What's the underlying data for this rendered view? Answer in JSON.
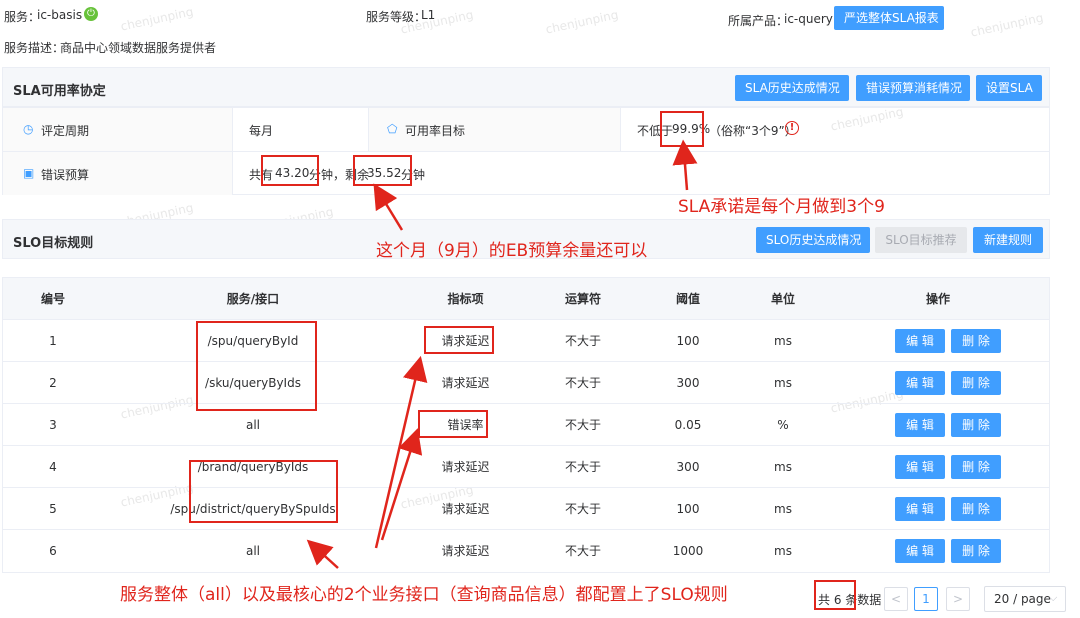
{
  "header": {
    "service_label": "服务：",
    "service_value": "ic-basis",
    "level_label": "服务等级：",
    "level_value": "L1",
    "product_label": "所属产品：",
    "product_value": "ic-query",
    "report_button": "严选整体SLA报表",
    "desc_label": "服务描述：",
    "desc_value": "商品中心领域数据服务提供者"
  },
  "sla": {
    "title": "SLA可用率协定",
    "history_button": "SLA历史达成情况",
    "budget_button": "错误预算消耗情况",
    "settings_button": "设置SLA",
    "period_label": "评定周期",
    "period_value": "每月",
    "target_label": "可用率目标",
    "target_prefix": "不低于",
    "target_value": "99.9%",
    "target_suffix": "（俗称“3个9”）",
    "budget_label": "错误预算",
    "budget_prefix": "共有",
    "budget_total": "43.20",
    "budget_mid": "分钟，剩余",
    "budget_remaining": "35.52",
    "budget_unit": "分钟"
  },
  "slo": {
    "title": "SLO目标规则",
    "history_button": "SLO历史达成情况",
    "recommend_button": "SLO目标推荐",
    "new_button": "新建规则"
  },
  "table": {
    "columns": [
      "编号",
      "服务/接口",
      "指标项",
      "运算符",
      "阈值",
      "单位",
      "操作"
    ],
    "rows": [
      [
        "1",
        "/spu/queryById",
        "请求延迟",
        "不大于",
        "100",
        "ms"
      ],
      [
        "2",
        "/sku/queryByIds",
        "请求延迟",
        "不大于",
        "300",
        "ms"
      ],
      [
        "3",
        "all",
        "错误率",
        "不大于",
        "0.05",
        "%"
      ],
      [
        "4",
        "/brand/queryByIds",
        "请求延迟",
        "不大于",
        "300",
        "ms"
      ],
      [
        "5",
        "/spu/district/queryBySpuIds",
        "请求延迟",
        "不大于",
        "100",
        "ms"
      ],
      [
        "6",
        "all",
        "请求延迟",
        "不大于",
        "1000",
        "ms"
      ]
    ],
    "edit_label": "编 辑",
    "delete_label": "删 除"
  },
  "pagination": {
    "total_text": "共 6 条数据",
    "current_page": "1",
    "page_size": "20 / page"
  },
  "annotations": {
    "sla_note": "SLA承诺是每个月做到3个9",
    "eb_note": "这个月（9月）的EB预算余量还可以",
    "slo_note": "服务整体（all）以及最核心的2个业务接口（查询商品信息）都配置上了SLO规则"
  },
  "watermark": "chenjunping",
  "colors": {
    "primary": "#409eff",
    "annotation": "#e0251c",
    "power_icon": "#67c23a"
  }
}
